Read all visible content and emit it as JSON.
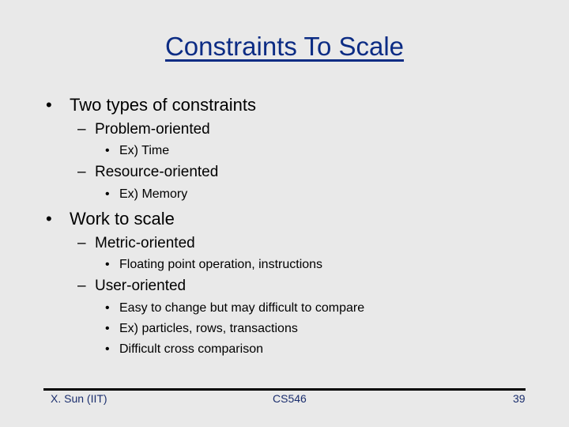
{
  "slide": {
    "title": "Constraints To Scale",
    "bullets": [
      {
        "text": "Two types of constraints",
        "sub": [
          {
            "text": "Problem-oriented",
            "sub": [
              "Ex) Time"
            ]
          },
          {
            "text": "Resource-oriented",
            "sub": [
              "Ex) Memory"
            ]
          }
        ]
      },
      {
        "text": "Work to scale",
        "sub": [
          {
            "text": "Metric-oriented",
            "sub": [
              "Floating point operation, instructions"
            ]
          },
          {
            "text": "User-oriented",
            "sub": [
              "Easy to change but may difficult to compare",
              "Ex) particles, rows, transactions",
              "Difficult cross comparison"
            ]
          }
        ]
      }
    ],
    "markers": {
      "level1": "•",
      "level2": "–",
      "level3": "•"
    }
  },
  "footer": {
    "author": "X. Sun (IIT)",
    "course": "CS546",
    "page_number": "39"
  }
}
